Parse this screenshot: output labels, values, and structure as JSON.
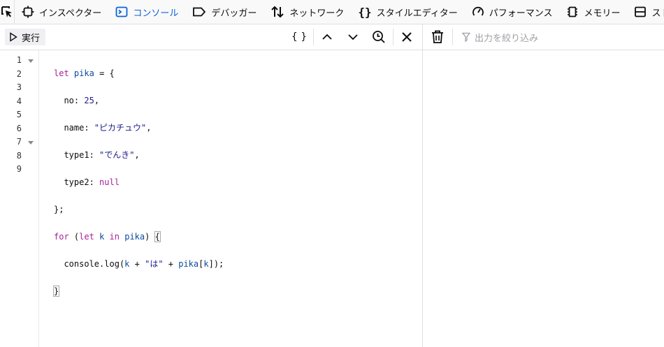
{
  "toolbar": {
    "tabs": [
      {
        "label": "インスペクター",
        "icon": "inspector-icon"
      },
      {
        "label": "コンソール",
        "icon": "console-icon",
        "active": true
      },
      {
        "label": "デバッガー",
        "icon": "debugger-icon"
      },
      {
        "label": "ネットワーク",
        "icon": "network-icon"
      },
      {
        "label": "スタイルエディター",
        "icon": "style-editor-icon"
      },
      {
        "label": "パフォーマンス",
        "icon": "performance-icon"
      },
      {
        "label": "メモリー",
        "icon": "memory-icon"
      },
      {
        "label": "ストレー",
        "icon": "storage-icon"
      }
    ]
  },
  "editor": {
    "run_label": "実行",
    "pretty_print_label": "{ }",
    "lines": [
      "1",
      "2",
      "3",
      "4",
      "5",
      "6",
      "7",
      "8",
      "9"
    ]
  },
  "output": {
    "filter_placeholder": "出力を絞り込み"
  },
  "colors": {
    "accent": "#0a64d6",
    "keyword": "#aa2196",
    "string": "#1a1a8c"
  }
}
